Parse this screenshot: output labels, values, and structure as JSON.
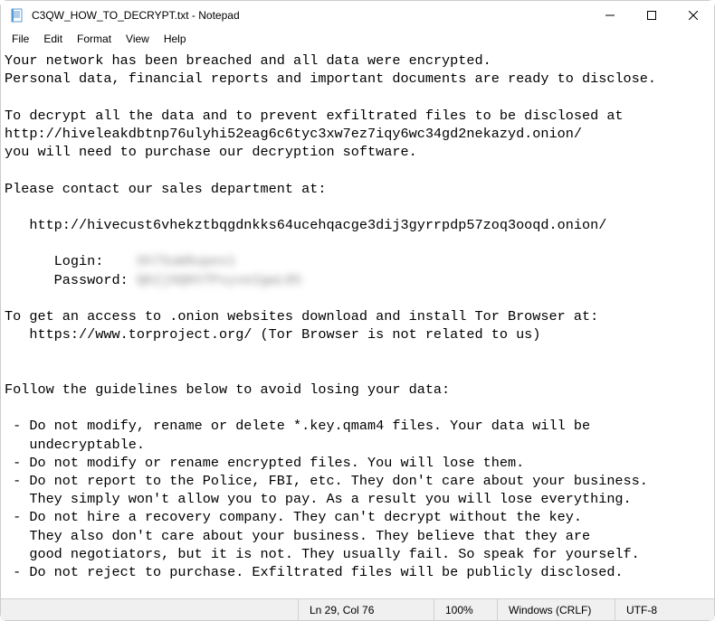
{
  "titlebar": {
    "title": "C3QW_HOW_TO_DECRYPT.txt - Notepad"
  },
  "menubar": {
    "file": "File",
    "edit": "Edit",
    "format": "Format",
    "view": "View",
    "help": "Help"
  },
  "content": {
    "l1": "Your network has been breached and all data were encrypted.",
    "l2": "Personal data, financial reports and important documents are ready to disclose.",
    "l3": "",
    "l4": "To decrypt all the data and to prevent exfiltrated files to be disclosed at ",
    "l5": "http://hiveleakdbtnp76ulyhi52eag6c6tyc3xw7ez7iqy6wc34gd2nekazyd.onion/",
    "l6": "you will need to purchase our decryption software.",
    "l7": "",
    "l8": "Please contact our sales department at:",
    "l9": "",
    "l10": "   http://hivecust6vhekztbqgdnkks64ucehqacge3dij3gyrrpdp57zoq3ooqd.onion/",
    "l11": "",
    "l12a": "      Login:    ",
    "l12b": "Sh7SuW9upes1",
    "l13a": "      Password: ",
    "l13b": "QK2j9QKhTPxyve2gwL85",
    "l14": "",
    "l15": "To get an access to .onion websites download and install Tor Browser at:",
    "l16": "   https://www.torproject.org/ (Tor Browser is not related to us)",
    "l17": "",
    "l18": "",
    "l19": "Follow the guidelines below to avoid losing your data:",
    "l20": "",
    "l21": " - Do not modify, rename or delete *.key.qmam4 files. Your data will be ",
    "l22": "   undecryptable.",
    "l23": " - Do not modify or rename encrypted files. You will lose them.",
    "l24": " - Do not report to the Police, FBI, etc. They don't care about your business.",
    "l25": "   They simply won't allow you to pay. As a result you will lose everything.",
    "l26": " - Do not hire a recovery company. They can't decrypt without the key.  ",
    "l27": "   They also don't care about your business. They believe that they are ",
    "l28": "   good negotiators, but it is not. They usually fail. So speak for yourself.",
    "l29": " - Do not reject to purchase. Exfiltrated files will be publicly disclosed."
  },
  "statusbar": {
    "lncol": "Ln 29, Col 76",
    "zoom": "100%",
    "eol": "Windows (CRLF)",
    "encoding": "UTF-8"
  }
}
